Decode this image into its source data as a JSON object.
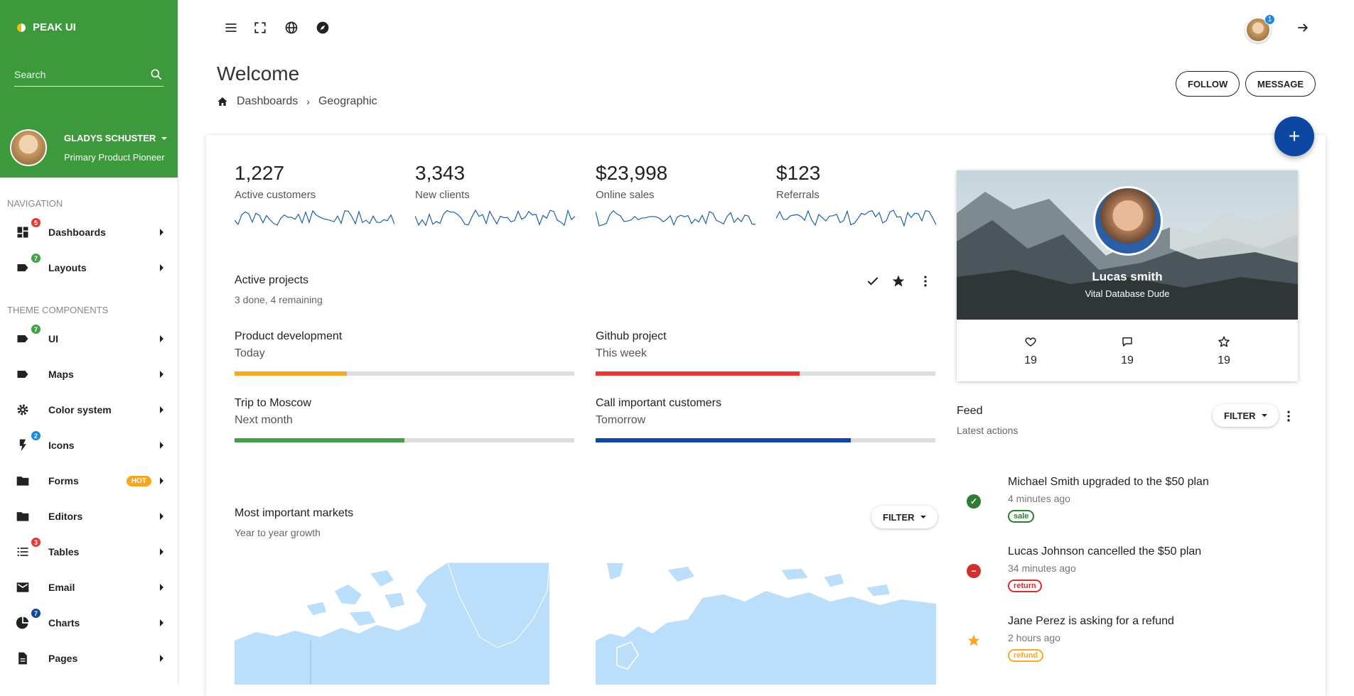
{
  "brand": "PEAK UI",
  "search": {
    "placeholder": "Search"
  },
  "user": {
    "name": "GLADYS SCHUSTER",
    "role": "Primary Product Pioneer"
  },
  "nav": {
    "section1": "NAVIGATION",
    "section2": "THEME COMPONENTS",
    "items": [
      {
        "label": "Dashboards",
        "icon": "dashboard-icon",
        "badge": "5",
        "badge_color": "#e53935"
      },
      {
        "label": "Layouts",
        "icon": "label-icon",
        "badge": "7",
        "badge_color": "#43a047"
      },
      {
        "label": "UI",
        "icon": "label-icon",
        "badge": "7",
        "badge_color": "#43a047"
      },
      {
        "label": "Maps",
        "icon": "label-icon"
      },
      {
        "label": "Color system",
        "icon": "gear-icon"
      },
      {
        "label": "Icons",
        "icon": "flash-icon",
        "badge": "2",
        "badge_color": "#1e88e5"
      },
      {
        "label": "Forms",
        "icon": "folder-icon",
        "tag": "HOT"
      },
      {
        "label": "Editors",
        "icon": "folder-icon"
      },
      {
        "label": "Tables",
        "icon": "list-icon",
        "badge": "3",
        "badge_color": "#e53935"
      },
      {
        "label": "Email",
        "icon": "mail-icon"
      },
      {
        "label": "Charts",
        "icon": "pie-chart-icon",
        "badge": "7",
        "badge_color": "#0d47a1"
      },
      {
        "label": "Pages",
        "icon": "file-icon"
      }
    ]
  },
  "header": {
    "title": "Welcome",
    "breadcrumb": [
      "Dashboards",
      "Geographic"
    ],
    "follow": "FOLLOW",
    "message": "MESSAGE",
    "notification_count": "1"
  },
  "stats": [
    {
      "value": "1,227",
      "label": "Active customers"
    },
    {
      "value": "3,343",
      "label": "New clients"
    },
    {
      "value": "$23,998",
      "label": "Online sales"
    },
    {
      "value": "$123",
      "label": "Referrals"
    }
  ],
  "projects": {
    "title": "Active projects",
    "subtitle": "3 done, 4 remaining",
    "items": [
      {
        "name": "Product development",
        "when": "Today",
        "progress": 0.33,
        "color": "#f9a825"
      },
      {
        "name": "Github project",
        "when": "This week",
        "progress": 0.6,
        "color": "#e53935"
      },
      {
        "name": "Trip to Moscow",
        "when": "Next month",
        "progress": 0.5,
        "color": "#43a047"
      },
      {
        "name": "Call important customers",
        "when": "Tomorrow",
        "progress": 0.75,
        "color": "#0d47a1"
      }
    ]
  },
  "markets": {
    "title": "Most important markets",
    "subtitle": "Year to year growth",
    "filter": "FILTER"
  },
  "profile": {
    "name": "Lucas smith",
    "role": "Vital Database Dude",
    "likes": "19",
    "comments": "19",
    "stars": "19"
  },
  "feed": {
    "title": "Feed",
    "subtitle": "Latest actions",
    "filter": "FILTER",
    "items": [
      {
        "text": "Michael Smith upgraded to the $50 plan",
        "time": "4 minutes ago",
        "tag": "sale",
        "color": "#43a047"
      },
      {
        "text": "Lucas Johnson cancelled the $50 plan",
        "time": "34 minutes ago",
        "tag": "return",
        "color": "#d32f2f"
      },
      {
        "text": "Jane Perez is asking for a refund",
        "time": "2 hours ago",
        "tag": "refund",
        "color": "#f9a825"
      }
    ]
  }
}
